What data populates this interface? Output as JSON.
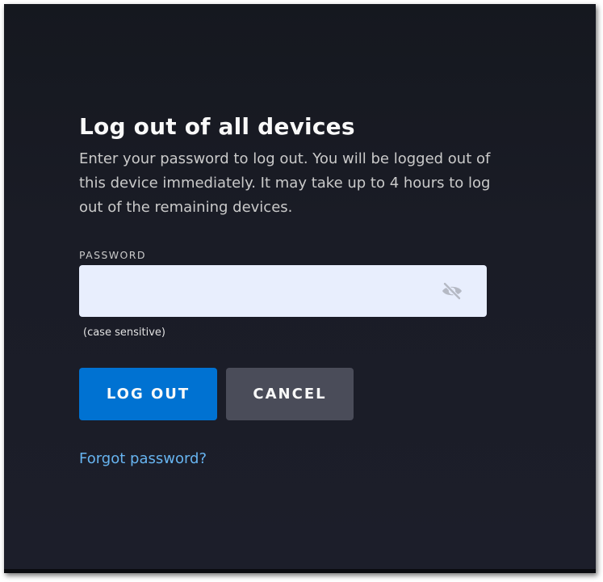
{
  "dialog": {
    "title": "Log out of all devices",
    "description": "Enter your password to log out. You will be logged out of this device immediately. It may take up to 4 hours to log out of the remaining devices."
  },
  "password": {
    "label": "PASSWORD",
    "value": "",
    "placeholder": "",
    "hint": "(case sensitive)",
    "toggle_icon": "eye-slash-icon"
  },
  "actions": {
    "logout_label": "LOG OUT",
    "cancel_label": "CANCEL",
    "forgot_label": "Forgot password?"
  },
  "colors": {
    "background": "#1a1c26",
    "primary": "#0072d2",
    "secondary": "#4a4c59",
    "link": "#67b4f0",
    "input_bg": "#e8eefd"
  }
}
